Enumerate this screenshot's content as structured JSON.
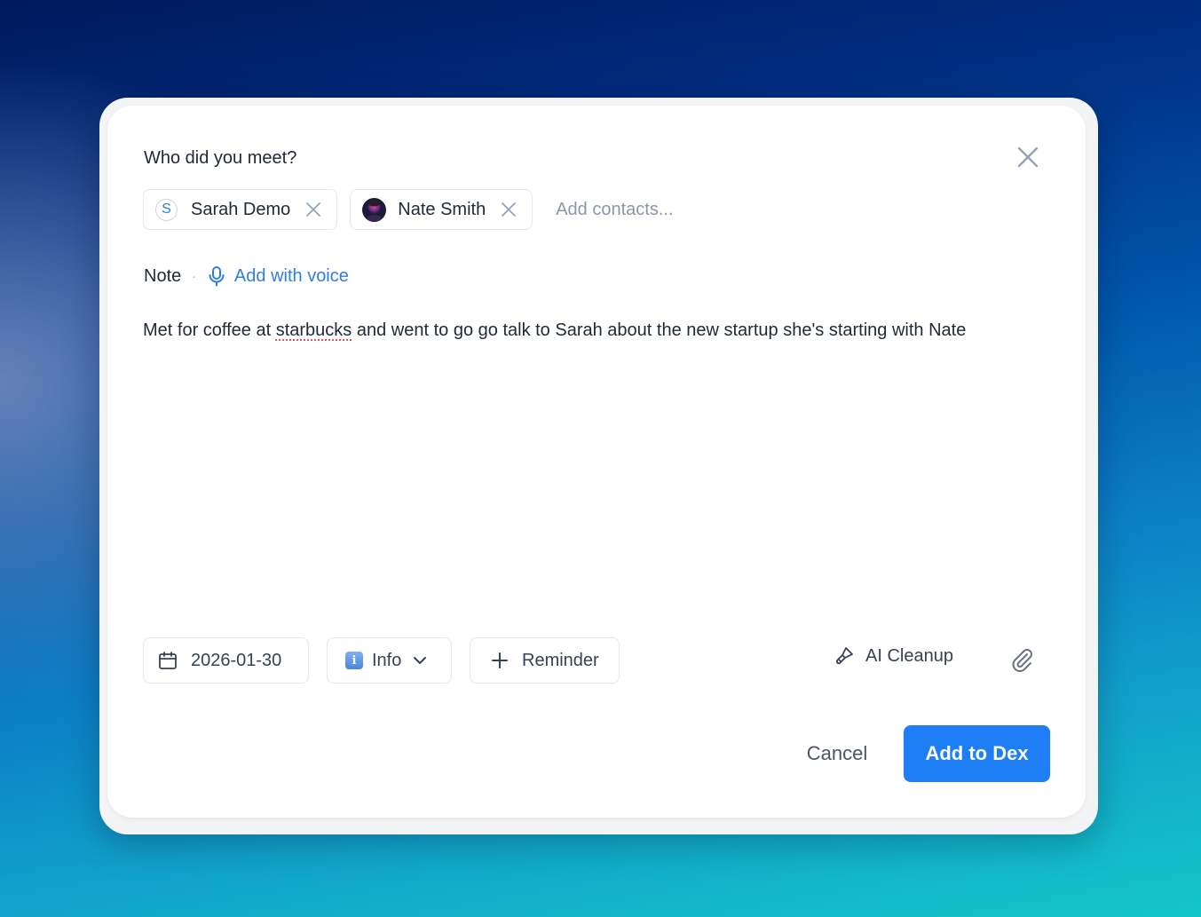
{
  "dialog": {
    "title": "Who did you meet?",
    "close_icon": "close-icon"
  },
  "contacts": {
    "chips": [
      {
        "name": "Sarah Demo",
        "avatar_letter": "S"
      },
      {
        "name": "Nate Smith",
        "avatar": "photo-avatar"
      }
    ],
    "placeholder": "Add contacts..."
  },
  "note": {
    "label": "Note",
    "separator": "·",
    "voice_label": "Add with voice",
    "text_before": "Met for coffee at ",
    "text_misspelled": "starbucks",
    "text_after": " and went to go go talk to Sarah about the new startup she's starting with Nate"
  },
  "toolbar": {
    "date": "2026-01-30",
    "type_label": "Info",
    "type_icon_glyph": "i",
    "reminder_label": "Reminder",
    "ai_cleanup_label": "AI Cleanup",
    "attach_icon": "paperclip-icon"
  },
  "actions": {
    "cancel_label": "Cancel",
    "submit_label": "Add to Dex"
  },
  "colors": {
    "accent": "#1d7ef5",
    "link": "#2f7fe0",
    "text": "#1f2937",
    "border": "#e5e7eb"
  }
}
